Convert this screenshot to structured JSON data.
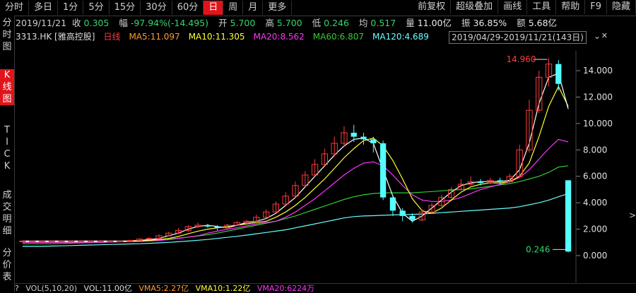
{
  "toolbar": {
    "periods": [
      "分时",
      "多日",
      "1分",
      "5分",
      "15分",
      "30分",
      "60分",
      "日",
      "周",
      "月",
      "更多"
    ],
    "active_period": "日",
    "right": [
      "前复权",
      "超级叠加",
      "画线",
      "工具",
      "帮助",
      "F9",
      "隐藏"
    ]
  },
  "leftnav": {
    "items": [
      {
        "label": "分时图",
        "chars": [
          "分",
          "时",
          "图"
        ],
        "active": false
      },
      {
        "label": "K线图",
        "chars": [
          "K",
          "线",
          "图"
        ],
        "active": true
      },
      {
        "label": "TICK",
        "chars": [
          "T",
          "I",
          "C",
          "K"
        ],
        "active": false
      },
      {
        "label": "成交明细",
        "chars": [
          "成",
          "交",
          "明",
          "细"
        ],
        "active": false
      },
      {
        "label": "分价表",
        "chars": [
          "分",
          "价",
          "表"
        ],
        "active": false
      }
    ]
  },
  "info": {
    "date": "2019/11/21",
    "close_label": "收",
    "close": "0.305",
    "change_label": "幅",
    "change": "-97.94%(-14.495)",
    "open_label": "开",
    "open": "5.700",
    "high_label": "高",
    "high": "5.700",
    "low_label": "低",
    "low": "0.246",
    "avg_label": "均",
    "avg": "0.517",
    "volume_label": "量",
    "volume": "11.00亿",
    "amplitude_label": "振",
    "amplitude": "36.85%",
    "amount_label": "额",
    "amount": "5.68亿"
  },
  "ma": {
    "symbol": "3313.HK [雅高控股]",
    "kline_label": "日线",
    "ma5": "MA5:11.097",
    "ma10": "MA10:11.305",
    "ma20": "MA20:8.562",
    "ma60": "MA60:6.807",
    "ma120": "MA120:4.689",
    "date_range": "2019/04/29-2019/11/21(143日)"
  },
  "colors": {
    "up": "#ff3b3b",
    "down": "#54ffff",
    "ma5": "#ffffff",
    "ma10": "#ffff33",
    "ma20": "#ff33ff",
    "ma60": "#33cc33",
    "ma120": "#66ffff",
    "axis": "#e0e0e0"
  },
  "chart_data": {
    "type": "candlestick",
    "ylim": [
      0,
      15.5
    ],
    "y_ticks": [
      "14.000",
      "12.000",
      "10.000",
      "8.000",
      "6.000",
      "4.000",
      "2.000",
      "0.000"
    ],
    "y_tick_values": [
      14,
      12,
      10,
      8,
      6,
      4,
      2,
      0
    ],
    "max_label": "14.960",
    "min_label": "0.246",
    "ma5": [
      1.1,
      1.1,
      1.1,
      1.1,
      1.1,
      1.1,
      1.1,
      1.1,
      1.1,
      1.1,
      1.1,
      1.1,
      1.15,
      1.2,
      1.3,
      1.5,
      1.7,
      2.0,
      2.2,
      2.3,
      2.2,
      2.1,
      2.3,
      2.5,
      2.6,
      2.8,
      3.2,
      3.8,
      4.4,
      5.2,
      6.0,
      6.8,
      7.6,
      8.3,
      8.8,
      8.9,
      8.5,
      6.5,
      4.5,
      3.2,
      2.6,
      3.0,
      3.6,
      4.2,
      4.8,
      5.3,
      5.5,
      5.6,
      5.6,
      5.6,
      5.7,
      6.5,
      8.5,
      11.5,
      13.5,
      13.8,
      11.1
    ],
    "ma10": [
      1.05,
      1.05,
      1.05,
      1.05,
      1.05,
      1.05,
      1.05,
      1.05,
      1.05,
      1.05,
      1.06,
      1.08,
      1.1,
      1.15,
      1.2,
      1.3,
      1.45,
      1.65,
      1.85,
      2.0,
      2.1,
      2.2,
      2.3,
      2.4,
      2.5,
      2.6,
      2.9,
      3.3,
      3.8,
      4.4,
      5.1,
      5.8,
      6.6,
      7.4,
      8.1,
      8.7,
      8.9,
      8.3,
      7.2,
      5.8,
      4.3,
      3.4,
      3.2,
      3.6,
      4.2,
      4.8,
      5.2,
      5.4,
      5.5,
      5.5,
      5.6,
      6.0,
      7.0,
      9.0,
      11.3,
      12.8,
      11.3
    ],
    "ma20": [
      1.0,
      1.0,
      1.0,
      1.0,
      1.0,
      1.0,
      1.0,
      1.0,
      1.0,
      1.02,
      1.04,
      1.06,
      1.08,
      1.1,
      1.15,
      1.2,
      1.3,
      1.4,
      1.5,
      1.7,
      1.85,
      2.0,
      2.1,
      2.25,
      2.4,
      2.5,
      2.6,
      2.9,
      3.3,
      3.8,
      4.3,
      4.9,
      5.5,
      6.1,
      6.6,
      7.0,
      7.1,
      6.8,
      6.1,
      5.3,
      4.6,
      4.2,
      4.1,
      4.1,
      4.2,
      4.4,
      4.7,
      5.0,
      5.2,
      5.4,
      5.6,
      5.9,
      6.5,
      7.3,
      8.1,
      8.8,
      8.6
    ],
    "ma60": [
      0.9,
      0.9,
      0.9,
      0.9,
      0.92,
      0.94,
      0.96,
      0.98,
      1.0,
      1.02,
      1.05,
      1.08,
      1.12,
      1.16,
      1.2,
      1.26,
      1.32,
      1.4,
      1.48,
      1.58,
      1.7,
      1.85,
      2.0,
      2.15,
      2.3,
      2.45,
      2.6,
      2.8,
      3.0,
      3.25,
      3.5,
      3.75,
      4.0,
      4.25,
      4.45,
      4.6,
      4.7,
      4.75,
      4.75,
      4.75,
      4.75,
      4.8,
      4.85,
      4.9,
      4.95,
      5.0,
      5.05,
      5.15,
      5.25,
      5.35,
      5.45,
      5.6,
      5.8,
      6.0,
      6.3,
      6.7,
      6.8
    ],
    "ma120": [
      0.7,
      0.7,
      0.7,
      0.72,
      0.74,
      0.76,
      0.78,
      0.8,
      0.82,
      0.84,
      0.86,
      0.88,
      0.9,
      0.93,
      0.96,
      1.0,
      1.05,
      1.1,
      1.16,
      1.22,
      1.3,
      1.38,
      1.46,
      1.55,
      1.65,
      1.75,
      1.85,
      1.95,
      2.1,
      2.25,
      2.4,
      2.55,
      2.7,
      2.85,
      2.95,
      3.0,
      3.02,
      3.05,
      3.08,
      3.1,
      3.12,
      3.15,
      3.2,
      3.25,
      3.3,
      3.35,
      3.4,
      3.45,
      3.5,
      3.55,
      3.6,
      3.7,
      3.85,
      4.0,
      4.2,
      4.45,
      4.69
    ],
    "candles": [
      [
        1.1,
        1.1,
        1.05,
        1.15
      ],
      [
        1.1,
        1.1,
        1.05,
        1.15
      ],
      [
        1.1,
        1.1,
        1.05,
        1.15
      ],
      [
        1.1,
        1.1,
        1.05,
        1.15
      ],
      [
        1.1,
        1.1,
        1.05,
        1.15
      ],
      [
        1.1,
        1.1,
        1.05,
        1.15
      ],
      [
        1.1,
        1.1,
        1.05,
        1.15
      ],
      [
        1.1,
        1.1,
        1.05,
        1.15
      ],
      [
        1.1,
        1.1,
        1.05,
        1.15
      ],
      [
        1.1,
        1.1,
        1.05,
        1.15
      ],
      [
        1.1,
        1.1,
        1.05,
        1.15
      ],
      [
        1.1,
        1.15,
        1.05,
        1.2
      ],
      [
        1.15,
        1.25,
        1.1,
        1.3
      ],
      [
        1.25,
        1.3,
        1.2,
        1.4
      ],
      [
        1.3,
        1.5,
        1.25,
        1.6
      ],
      [
        1.5,
        1.7,
        1.45,
        1.8
      ],
      [
        1.7,
        1.9,
        1.6,
        2.1
      ],
      [
        1.9,
        2.2,
        1.8,
        2.3
      ],
      [
        2.2,
        2.3,
        2.1,
        2.5
      ],
      [
        2.3,
        2.2,
        2.1,
        2.4
      ],
      [
        2.2,
        2.1,
        1.9,
        2.3
      ],
      [
        2.1,
        2.3,
        2.0,
        2.4
      ],
      [
        2.3,
        2.5,
        2.2,
        2.6
      ],
      [
        2.5,
        2.6,
        2.4,
        2.7
      ],
      [
        2.6,
        2.9,
        2.5,
        3.1
      ],
      [
        2.9,
        3.3,
        2.8,
        3.5
      ],
      [
        3.3,
        3.9,
        3.2,
        4.1
      ],
      [
        3.9,
        4.5,
        3.8,
        4.8
      ],
      [
        4.5,
        5.3,
        4.4,
        5.6
      ],
      [
        5.3,
        6.1,
        5.2,
        6.4
      ],
      [
        6.1,
        6.9,
        6.0,
        7.3
      ],
      [
        6.9,
        7.7,
        6.8,
        8.1
      ],
      [
        7.7,
        8.5,
        7.5,
        9.0
      ],
      [
        8.5,
        9.3,
        8.2,
        9.8
      ],
      [
        9.3,
        9.0,
        8.6,
        9.9
      ],
      [
        9.0,
        8.8,
        8.4,
        9.3
      ],
      [
        8.8,
        8.5,
        7.8,
        9.0
      ],
      [
        8.5,
        4.4,
        4.2,
        8.7
      ],
      [
        4.4,
        3.4,
        3.0,
        4.6
      ],
      [
        3.4,
        3.0,
        2.6,
        3.6
      ],
      [
        3.0,
        2.7,
        2.5,
        3.2
      ],
      [
        2.7,
        3.3,
        2.6,
        3.5
      ],
      [
        3.3,
        3.8,
        3.2,
        4.0
      ],
      [
        3.8,
        4.4,
        3.7,
        4.6
      ],
      [
        4.4,
        5.0,
        4.3,
        5.2
      ],
      [
        5.0,
        5.4,
        4.9,
        5.8
      ],
      [
        5.4,
        5.6,
        5.3,
        6.0
      ],
      [
        5.6,
        5.5,
        5.3,
        5.8
      ],
      [
        5.5,
        5.7,
        5.4,
        5.9
      ],
      [
        5.7,
        5.6,
        5.4,
        5.9
      ],
      [
        5.6,
        6.0,
        5.5,
        6.2
      ],
      [
        6.0,
        8.0,
        5.9,
        8.4
      ],
      [
        8.0,
        11.0,
        7.8,
        11.8
      ],
      [
        11.0,
        13.5,
        10.8,
        14.0
      ],
      [
        13.5,
        14.5,
        12.8,
        14.96
      ],
      [
        14.5,
        13.0,
        12.5,
        14.8
      ],
      [
        5.7,
        0.305,
        0.246,
        5.7
      ]
    ]
  },
  "volume_line": {
    "vol_label": "VOL(5,10,20)",
    "vol": "VOL:11.00亿",
    "vma5": "VMA5:2.27亿",
    "vma10": "VMA10:1.22亿",
    "vma20": "VMA20:6224万"
  }
}
